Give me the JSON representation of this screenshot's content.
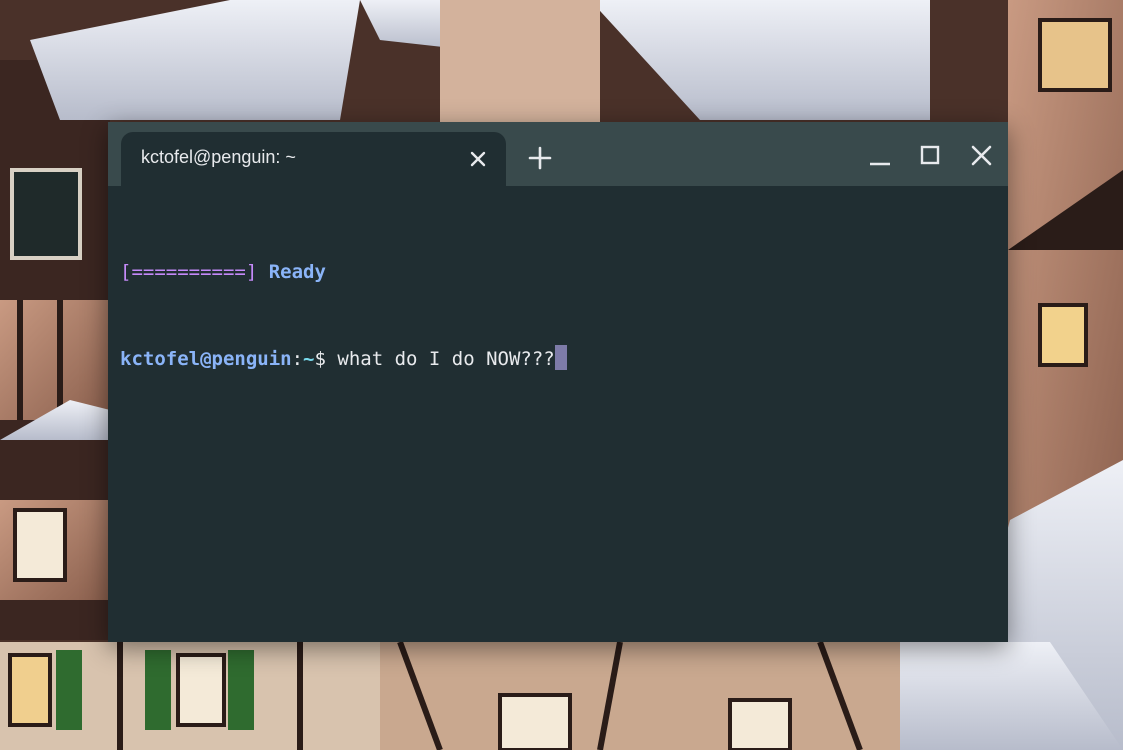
{
  "window": {
    "tab_title": "kctofel@penguin: ~",
    "new_tab_icon": "plus-icon",
    "tab_close_icon": "close-icon",
    "controls": [
      "minimize-icon",
      "maximize-icon",
      "close-icon"
    ]
  },
  "terminal": {
    "lines": [
      {
        "progress": "[==========]",
        "status": "Ready"
      },
      {
        "user_host": "kctofel@penguin",
        "separator": ":",
        "path": "~",
        "symbol": "$",
        "command": " what do I do NOW???"
      }
    ]
  },
  "colors": {
    "titlebar": "#394a4c",
    "terminal_bg": "#202e32",
    "progress": "#c58af9",
    "user_host": "#8ab4f8",
    "path": "#78d9ec",
    "text": "#e8eaed",
    "cursor": "#7d7ba8"
  }
}
